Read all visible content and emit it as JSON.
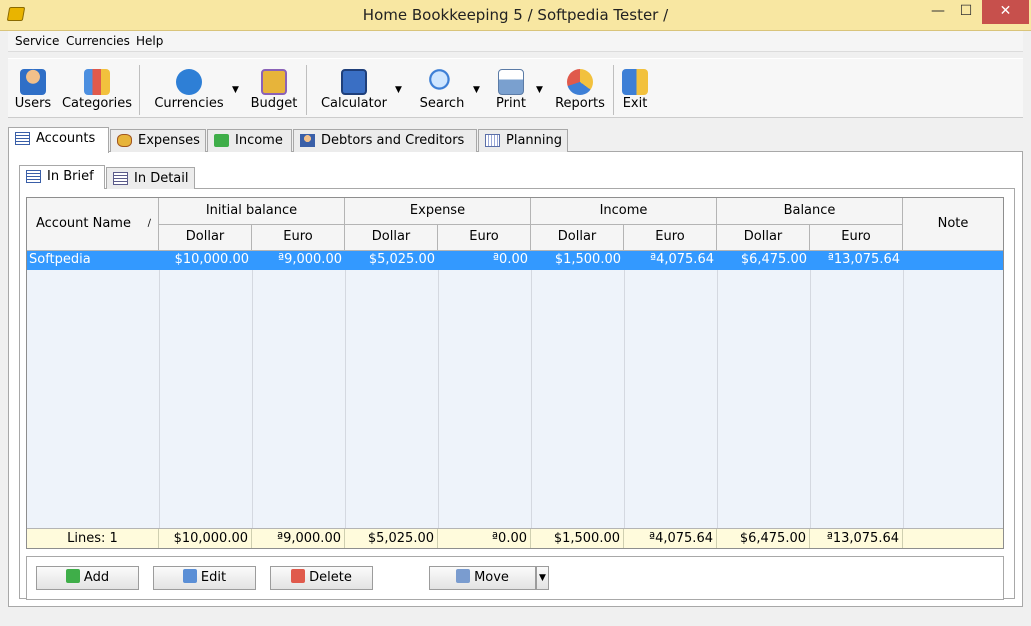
{
  "window": {
    "title": "Home Bookkeeping 5  / Softpedia Tester /",
    "minimize": "—",
    "maximize": "☐",
    "close": "✕"
  },
  "menu": [
    "Service",
    "Currencies",
    "Help"
  ],
  "toolbar": {
    "users": "Users",
    "categories": "Categories",
    "currencies": "Currencies",
    "budget": "Budget",
    "calculator": "Calculator",
    "search": "Search",
    "print": "Print",
    "reports": "Reports",
    "exit": "Exit",
    "dropdown": "▼"
  },
  "tabs": [
    "Accounts",
    "Expenses",
    "Income",
    "Debtors and Creditors",
    "Planning"
  ],
  "subtabs": [
    "In Brief",
    "In Detail"
  ],
  "grid": {
    "headers": {
      "account_name": "Account Name",
      "sort_mark": "∕",
      "initial_balance": "Initial balance",
      "expense": "Expense",
      "income": "Income",
      "balance": "Balance",
      "note": "Note",
      "dollar": "Dollar",
      "euro": "Euro"
    },
    "rows": [
      {
        "name": "Softpedia",
        "initial_dollar": "$10,000.00",
        "initial_euro": "ª9,000.00",
        "expense_dollar": "$5,025.00",
        "expense_euro": "ª0.00",
        "income_dollar": "$1,500.00",
        "income_euro": "ª4,075.64",
        "balance_dollar": "$6,475.00",
        "balance_euro": "ª13,075.64",
        "note": ""
      }
    ],
    "footer": {
      "lines": "Lines: 1",
      "initial_dollar": "$10,000.00",
      "initial_euro": "ª9,000.00",
      "expense_dollar": "$5,025.00",
      "expense_euro": "ª0.00",
      "income_dollar": "$1,500.00",
      "income_euro": "ª4,075.64",
      "balance_dollar": "$6,475.00",
      "balance_euro": "ª13,075.64"
    }
  },
  "buttons": {
    "add": "Add",
    "edit": "Edit",
    "delete": "Delete",
    "move": "Move",
    "move_dropdown": "▼"
  }
}
